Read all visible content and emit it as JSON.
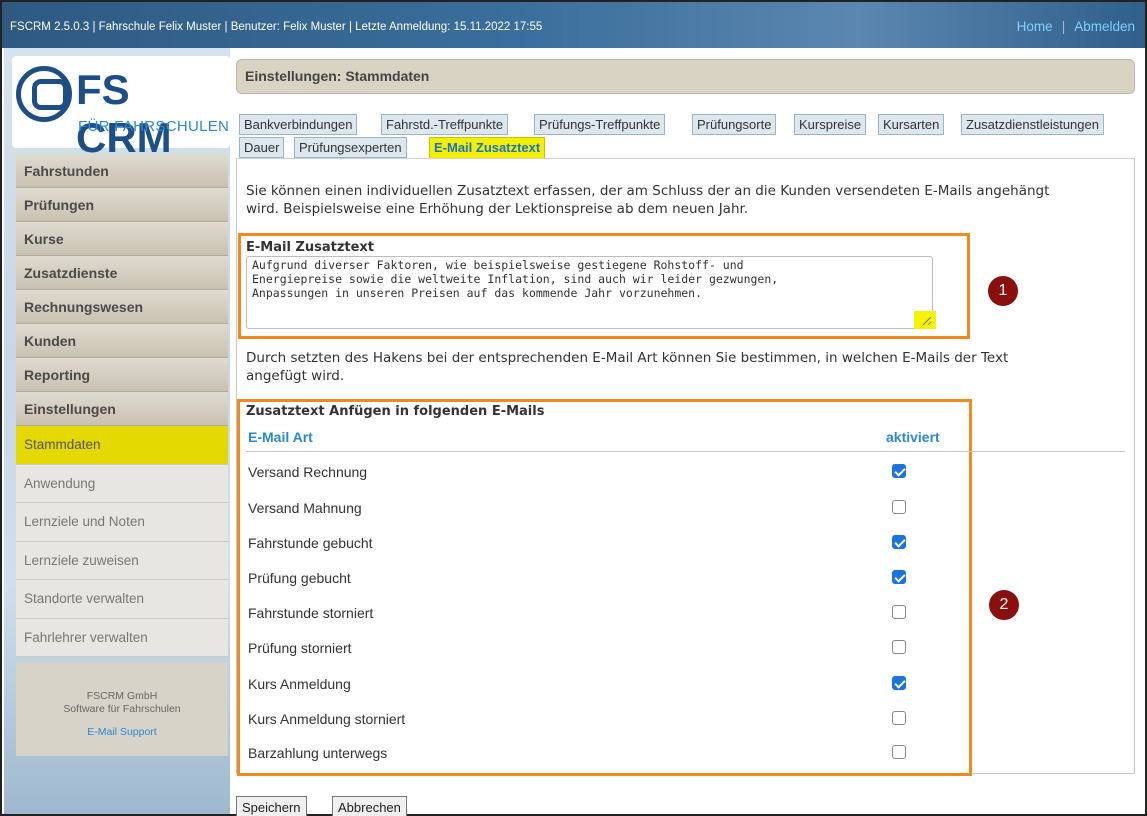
{
  "topbar": {
    "info": "FSCRM 2.5.0.3 | Fahrschule Felix Muster | Benutzer: Felix Muster | Letzte Anmeldung: 15.11.2022 17:55",
    "home": "Home",
    "separator": "|",
    "logout": "Abmelden"
  },
  "logo": {
    "title": "FS CRM",
    "subtitle": "FÜR FAHRSCHULEN"
  },
  "sidebar": {
    "main_items": [
      "Fahrstunden",
      "Prüfungen",
      "Kurse",
      "Zusatzdienste",
      "Rechnungswesen",
      "Kunden",
      "Reporting",
      "Einstellungen"
    ],
    "sub_items": [
      "Stammdaten",
      "Anwendung",
      "Lernziele und Noten",
      "Lernziele zuweisen",
      "Standorte verwalten",
      "Fahrlehrer verwalten"
    ],
    "active_sub": "Stammdaten",
    "footer": {
      "company": "FSCRM GmbH",
      "tagline": "Software für Fahrschulen",
      "support": "E-Mail Support"
    }
  },
  "page": {
    "title": "Einstellungen: Stammdaten"
  },
  "tabs": {
    "row1": [
      "Bankverbindungen",
      "Fahrstd.-Treffpunkte",
      "Prüfungs-Treffpunkte",
      "Prüfungsorte",
      "Kurspreise",
      "Kursarten",
      "Zusatzdienstleistungen"
    ],
    "row2": [
      "Dauer",
      "Prüfungsexperten",
      "E-Mail Zusatztext"
    ],
    "active": "E-Mail Zusatztext"
  },
  "content": {
    "intro_line1": "Sie können einen individuellen Zusatztext erfassen, der am Schluss der an die Kunden versendeten E-Mails angehängt",
    "intro_line2": "wird. Beispielsweise eine Erhöhung der Lektionspreise ab dem neuen Jahr.",
    "textarea_label": "E-Mail Zusatztext",
    "textarea_value": "Aufgrund diverser Faktoren, wie beispielsweise gestiegene Rohstoff- und\nEnergiepreise sowie die weltweite Inflation, sind auch wir leider gezwungen,\nAnpassungen in unseren Preisen auf das kommende Jahr vorzunehmen.",
    "info_line1": "Durch setzten des Hakens bei der entsprechenden E-Mail Art können Sie bestimmen, in welchen E-Mails der Text",
    "info_line2": "angefügt wird.",
    "section_title": "Zusatztext Anfügen in folgenden E-Mails",
    "col_type": "E-Mail Art",
    "col_active": "aktiviert",
    "rows": [
      {
        "label": "Versand Rechnung",
        "checked": true
      },
      {
        "label": "Versand Mahnung",
        "checked": false
      },
      {
        "label": "Fahrstunde gebucht",
        "checked": true
      },
      {
        "label": "Prüfung gebucht",
        "checked": true
      },
      {
        "label": "Fahrstunde storniert",
        "checked": false
      },
      {
        "label": "Prüfung storniert",
        "checked": false
      },
      {
        "label": "Kurs Anmeldung",
        "checked": true
      },
      {
        "label": "Kurs Anmeldung storniert",
        "checked": false
      },
      {
        "label": "Barzahlung unterwegs",
        "checked": false
      }
    ]
  },
  "markers": [
    "1",
    "2"
  ],
  "buttons": {
    "save": "Speichern",
    "cancel": "Abbrechen"
  },
  "colors": {
    "highlight": "#f2ef00",
    "annotation_box": "#f08a1c",
    "marker": "#8a1010",
    "link": "#2d87d2"
  }
}
